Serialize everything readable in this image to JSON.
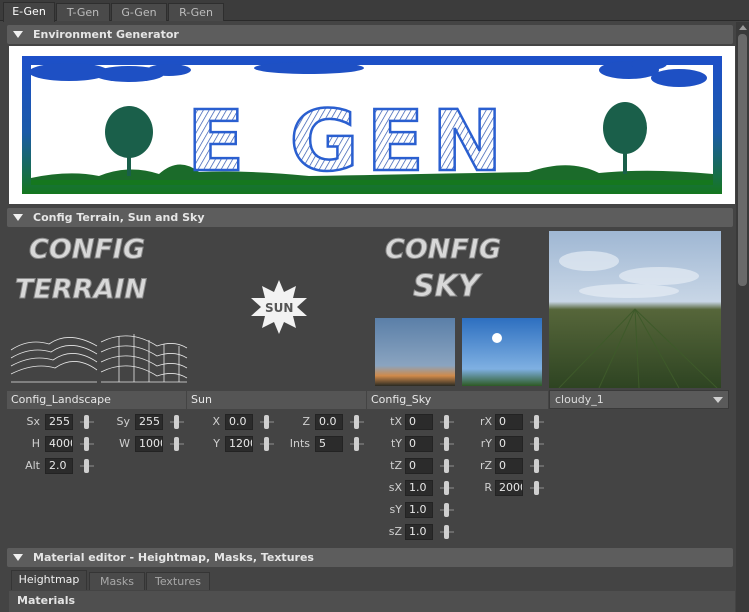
{
  "tabs": [
    "E-Gen",
    "T-Gen",
    "G-Gen",
    "R-Gen"
  ],
  "sections": {
    "environment": "Environment Generator",
    "config": "Config Terrain, Sun and Sky",
    "material": "Material editor - Heightmap, Masks, Textures"
  },
  "banner": {
    "text": "E GEN"
  },
  "config": {
    "terrain_art": [
      "CONFIG",
      "TERRAIN"
    ],
    "sun_art": "SUN",
    "sky_art": [
      "CONFIG",
      "SKY"
    ],
    "labels": {
      "landscape": "Config_Landscape",
      "sun": "Sun",
      "sky": "Config_Sky"
    },
    "sky_preset": "cloudy_1"
  },
  "params": {
    "landscape": [
      {
        "label": "Sx",
        "value": "255"
      },
      {
        "label": "Sy",
        "value": "255"
      },
      {
        "label": "H",
        "value": "4000"
      },
      {
        "label": "W",
        "value": "1000"
      },
      {
        "label": "Alt",
        "value": "2.0"
      }
    ],
    "sun": [
      {
        "label": "X",
        "value": "0.0"
      },
      {
        "label": "Z",
        "value": "0.0"
      },
      {
        "label": "Y",
        "value": "1200"
      },
      {
        "label": "Ints",
        "value": "5"
      }
    ],
    "sky": [
      {
        "label": "tX",
        "value": "0"
      },
      {
        "label": "rX",
        "value": "0"
      },
      {
        "label": "tY",
        "value": "0"
      },
      {
        "label": "rY",
        "value": "0"
      },
      {
        "label": "tZ",
        "value": "0"
      },
      {
        "label": "rZ",
        "value": "0"
      },
      {
        "label": "sX",
        "value": "1.0"
      },
      {
        "label": "R",
        "value": "2000"
      },
      {
        "label": "sY",
        "value": "1.0"
      },
      {
        "label": "sZ",
        "value": "1.0"
      }
    ]
  },
  "material_tabs": [
    "Heightmap",
    "Masks",
    "Textures"
  ],
  "materials_label": "Materials",
  "colors": {
    "banner_blue": "#1f56c4",
    "banner_green": "#1a7a22",
    "panel_bg": "#444444",
    "section_bg": "#5d5d5d"
  }
}
